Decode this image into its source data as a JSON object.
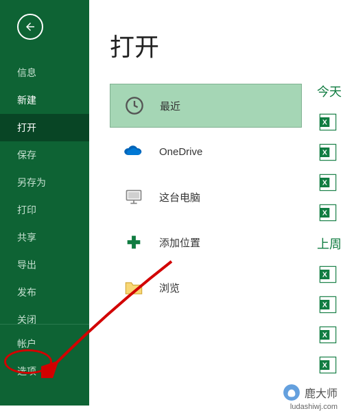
{
  "sidebar": {
    "items": [
      {
        "label": "信息"
      },
      {
        "label": "新建"
      },
      {
        "label": "打开"
      },
      {
        "label": "保存"
      },
      {
        "label": "另存为"
      },
      {
        "label": "打印"
      },
      {
        "label": "共享"
      },
      {
        "label": "导出"
      },
      {
        "label": "发布"
      },
      {
        "label": "关闭"
      }
    ],
    "bottom": [
      {
        "label": "帐户"
      },
      {
        "label": "选项"
      }
    ]
  },
  "main": {
    "title": "打开",
    "locations": [
      {
        "label": "最近",
        "icon": "clock"
      },
      {
        "label": "OneDrive",
        "icon": "onedrive"
      },
      {
        "label": "这台电脑",
        "icon": "computer"
      },
      {
        "label": "添加位置",
        "icon": "plus"
      },
      {
        "label": "浏览",
        "icon": "folder"
      }
    ]
  },
  "right": {
    "sections": [
      "今天",
      "上周"
    ]
  },
  "watermark": {
    "brand": "鹿大师",
    "url": "ludashiwj.com"
  }
}
